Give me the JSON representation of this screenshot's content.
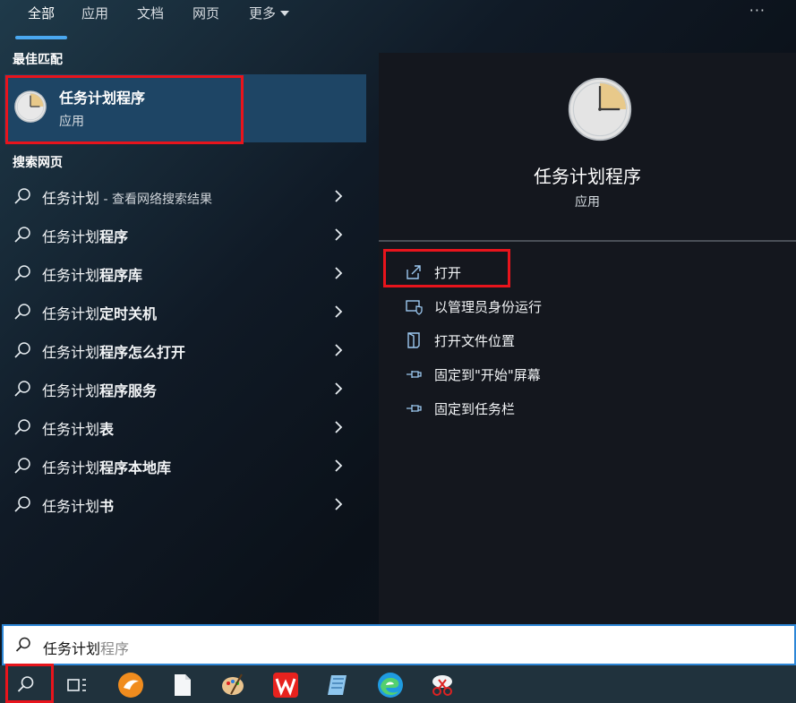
{
  "tabs": [
    {
      "label": "全部",
      "active": true
    },
    {
      "label": "应用"
    },
    {
      "label": "文档"
    },
    {
      "label": "网页"
    },
    {
      "label": "更多"
    }
  ],
  "options_label": "···",
  "best_match": {
    "heading": "最佳匹配",
    "title": "任务计划程序",
    "subtitle": "应用",
    "icon": "clock-icon"
  },
  "web_search": {
    "heading": "搜索网页",
    "items": [
      {
        "base": "任务计划",
        "bold": "",
        "suffix": " - 查看网络搜索结果"
      },
      {
        "base": "任务计划",
        "bold": "程序",
        "suffix": ""
      },
      {
        "base": "任务计划",
        "bold": "程序库",
        "suffix": ""
      },
      {
        "base": "任务计划",
        "bold": "定时关机",
        "suffix": ""
      },
      {
        "base": "任务计划",
        "bold": "程序怎么打开",
        "suffix": ""
      },
      {
        "base": "任务计划",
        "bold": "程序服务",
        "suffix": ""
      },
      {
        "base": "任务计划",
        "bold": "表",
        "suffix": ""
      },
      {
        "base": "任务计划",
        "bold": "程序本地库",
        "suffix": ""
      },
      {
        "base": "任务计划",
        "bold": "书",
        "suffix": ""
      }
    ]
  },
  "detail": {
    "title": "任务计划程序",
    "subtitle": "应用",
    "actions": [
      {
        "label": "打开",
        "icon": "open-icon"
      },
      {
        "label": "以管理员身份运行",
        "icon": "admin-shield-icon"
      },
      {
        "label": "打开文件位置",
        "icon": "file-location-icon"
      },
      {
        "label": "固定到\"开始\"屏幕",
        "icon": "pin-icon"
      },
      {
        "label": "固定到任务栏",
        "icon": "pin-icon"
      }
    ]
  },
  "search": {
    "typed": "任务计划",
    "completion": "程序"
  },
  "taskbar": [
    {
      "name": "search-icon"
    },
    {
      "name": "task-view-icon"
    },
    {
      "name": "app-orange-icon"
    },
    {
      "name": "document-icon"
    },
    {
      "name": "paint-palette-icon"
    },
    {
      "name": "wps-icon"
    },
    {
      "name": "notepad-icon"
    },
    {
      "name": "edge-icon"
    },
    {
      "name": "snipping-tool-icon"
    }
  ],
  "colors": {
    "accent": "#4aa8f0",
    "highlight": "#e8141c",
    "selected": "#1e4565"
  }
}
